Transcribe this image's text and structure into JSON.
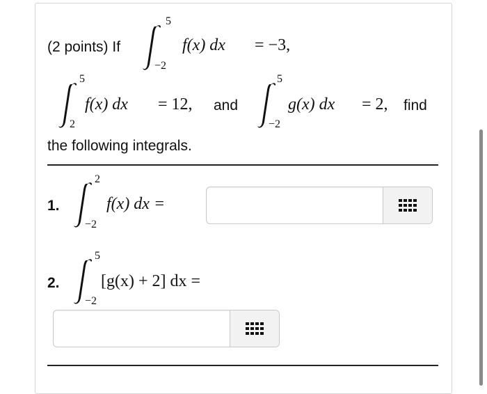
{
  "intro": {
    "points": "(2 points) If",
    "eq1_rhs": "= −3,",
    "eq2_rhs": "= 12,",
    "and": "and",
    "eq3_rhs": "= 2,",
    "find": "find",
    "line3": "the following integrals."
  },
  "integrand_f": "f(x) dx",
  "integrand_g": "g(x) dx",
  "integral1": {
    "upper": "5",
    "lower": "−2"
  },
  "integral2": {
    "upper": "5",
    "lower": "2"
  },
  "integral3": {
    "upper": "5",
    "lower": "−2"
  },
  "q1": {
    "number": "1.",
    "upper": "2",
    "lower": "−2",
    "expr": "f(x) dx =",
    "answer": ""
  },
  "q2": {
    "number": "2.",
    "upper": "5",
    "lower": "−2",
    "expr": "[g(x) + 2] dx =",
    "answer": ""
  },
  "icons": {
    "keyboard": "keypad-grid-icon"
  }
}
